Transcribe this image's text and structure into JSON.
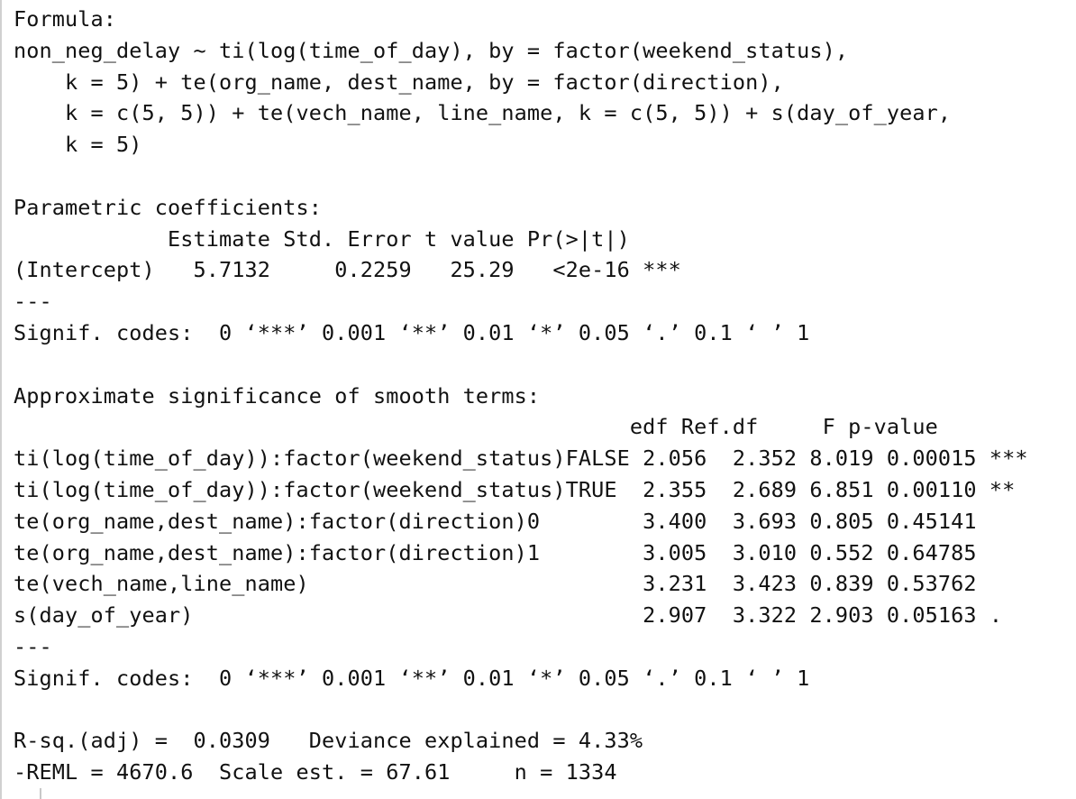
{
  "output_lines": [
    "Formula:",
    "non_neg_delay ~ ti(log(time_of_day), by = factor(weekend_status),",
    "    k = 5) + te(org_name, dest_name, by = factor(direction),",
    "    k = c(5, 5)) + te(vech_name, line_name, k = c(5, 5)) + s(day_of_year,",
    "    k = 5)",
    "",
    "Parametric coefficients:",
    "            Estimate Std. Error t value Pr(>|t|)",
    "(Intercept)   5.7132     0.2259   25.29   <2e-16 ***",
    "---",
    "Signif. codes:  0 ‘***’ 0.001 ‘**’ 0.01 ‘*’ 0.05 ‘.’ 0.1 ‘ ’ 1",
    "",
    "Approximate significance of smooth terms:",
    "                                                edf Ref.df     F p-value",
    "ti(log(time_of_day)):factor(weekend_status)FALSE 2.056  2.352 8.019 0.00015 ***",
    "ti(log(time_of_day)):factor(weekend_status)TRUE  2.355  2.689 6.851 0.00110 **",
    "te(org_name,dest_name):factor(direction)0        3.400  3.693 0.805 0.45141",
    "te(org_name,dest_name):factor(direction)1        3.005  3.010 0.552 0.64785",
    "te(vech_name,line_name)                          3.231  3.423 0.839 0.53762",
    "s(day_of_year)                                   2.907  3.322 2.903 0.05163 .",
    "---",
    "Signif. codes:  0 ‘***’ 0.001 ‘**’ 0.01 ‘*’ 0.05 ‘.’ 0.1 ‘ ’ 1",
    "",
    "R-sq.(adj) =  0.0309   Deviance explained = 4.33%",
    "-REML = 4670.6  Scale est. = 67.61     n = 1334"
  ]
}
